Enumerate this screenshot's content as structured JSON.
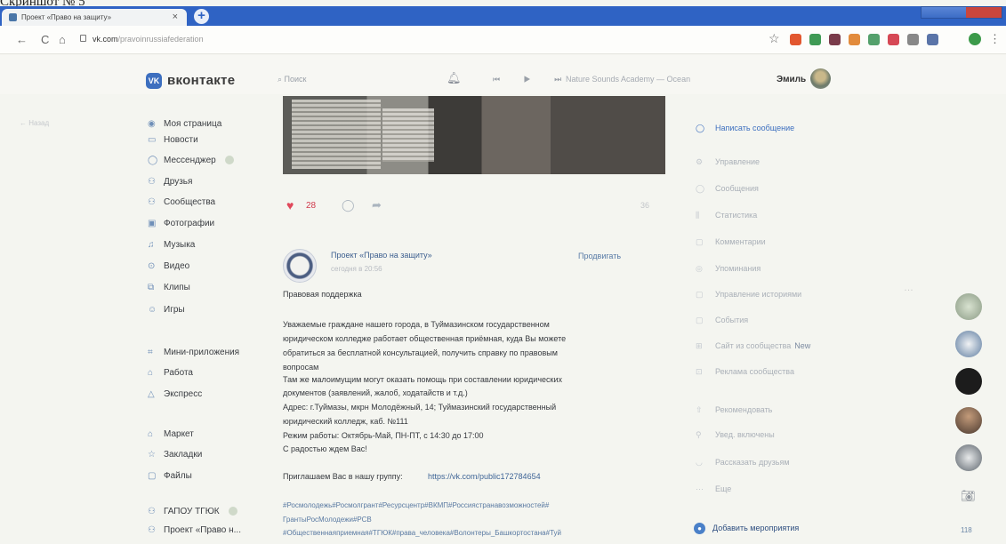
{
  "caption": "Скриншот № 5",
  "browser": {
    "tab_title": "Проект «Право на защиту»",
    "tab_close": "×",
    "new_tab": "+",
    "url_host": "vk.com",
    "url_path": "/pravoinrussiafederation"
  },
  "vk": {
    "logo_text": "вконтакте",
    "search_placeholder": "Поиск",
    "player_controls": "⏮ ▶ ⏭",
    "now_playing": "Nature Sounds Academy — Ocean",
    "user_name": "Эмиль"
  },
  "sidebar": {
    "back": "← Назад",
    "items": [
      {
        "label": "Моя страница",
        "icon": "user-icon"
      },
      {
        "label": "Новости",
        "icon": "news-icon"
      },
      {
        "label": "Мессенджер",
        "icon": "chat-icon"
      },
      {
        "label": "Друзья",
        "icon": "friends-icon"
      },
      {
        "label": "Сообщества",
        "icon": "groups-icon"
      },
      {
        "label": "Фотографии",
        "icon": "photo-icon"
      },
      {
        "label": "Музыка",
        "icon": "music-icon"
      },
      {
        "label": "Видео",
        "icon": "video-icon"
      },
      {
        "label": "Клипы",
        "icon": "clips-icon"
      },
      {
        "label": "Игры",
        "icon": "games-icon"
      },
      {
        "label": "Мини-приложения",
        "icon": "apps-icon"
      },
      {
        "label": "Работа",
        "icon": "work-icon"
      },
      {
        "label": "Экспресс",
        "icon": "express-icon"
      },
      {
        "label": "Маркет",
        "icon": "market-icon"
      },
      {
        "label": "Закладки",
        "icon": "bookmark-icon"
      },
      {
        "label": "Файлы",
        "icon": "files-icon"
      },
      {
        "label": "ГАПОУ ТГЮК",
        "icon": "group-icon"
      },
      {
        "label": "Проект «Право н...",
        "icon": "group-icon"
      }
    ]
  },
  "prev_post": {
    "likes": "28",
    "views": "36"
  },
  "post": {
    "author": "Проект «Право на защиту»",
    "time": "сегодня в 20:56",
    "promote": "Продвигать",
    "lines": [
      "Правовая поддержка",
      "",
      "Уважаемые граждане нашего города, в Туймазинском государственном",
      "юридическом колледже работает общественная приёмная, куда Вы можете",
      "обратиться за бесплатной консультацией, получить справку по правовым",
      "вопросам",
      "Там же малоимущим могут оказать помощь при составлении юридических",
      "документов (заявлений, жалоб, ходатайств и т.д.)",
      "Адрес: г.Туймазы, мкрн Молодёжный, 14; Туймазинский государственный",
      "юридический колледж, каб. №111",
      "Режим работы: Октябрь-Май, ПН-ПТ, с 14:30 до 17:00",
      "С радостью ждем Вас!",
      "",
      "Приглашаем Вас в нашу группу:"
    ],
    "group_link": "https://vk.com/public172784654",
    "tags": [
      "#Росмолодежь#Росмолгрант#Ресурсцентр#ВКМП#Россиястранавозможностей#",
      "ГрантыРосМолодежи#РСВ",
      "#Общественнаяприемная#ТГЮК#права_человека#Волонтеры_Башкортостана#Туй"
    ]
  },
  "right_panel": {
    "items": [
      {
        "label": "Написать сообщение",
        "icon": "message-icon"
      },
      {
        "label": "Управление",
        "icon": "settings-icon"
      },
      {
        "label": "Сообщения",
        "icon": "messages-icon"
      },
      {
        "label": "Статистика",
        "icon": "stats-icon"
      },
      {
        "label": "Комментарии",
        "icon": "comments-icon"
      },
      {
        "label": "Упоминания",
        "icon": "mentions-icon"
      },
      {
        "label": "Управление историями",
        "icon": "stories-icon"
      },
      {
        "label": "События",
        "icon": "events-icon"
      },
      {
        "label": "Сайт из сообщества",
        "icon": "site-icon"
      },
      {
        "label": "Реклама сообщества",
        "icon": "ads-icon"
      },
      {
        "label": "Рекомендовать",
        "icon": "recommend-icon"
      },
      {
        "label": "Увед. включены",
        "icon": "notify-icon"
      },
      {
        "label": "Рассказать друзьям",
        "icon": "share-icon"
      },
      {
        "label": "Еще",
        "icon": "more-icon"
      }
    ],
    "new_badge": "New",
    "bottom_action": "Добавить мероприятия"
  },
  "floating": {
    "online_count": "118"
  }
}
